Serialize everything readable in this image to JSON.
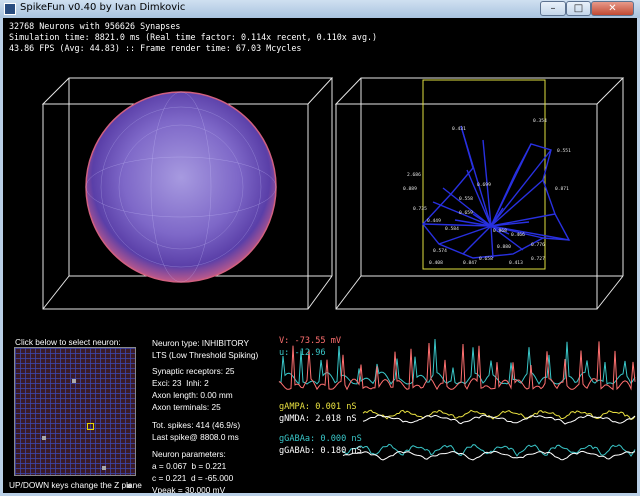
{
  "window": {
    "title": "SpikeFun v0.40 by Ivan Dimkovic",
    "min_glyph": "–",
    "max_glyph": "□",
    "close_glyph": "✕"
  },
  "stats": {
    "line1": "32768 Neurons with 956626 Synapses",
    "line2": "Simulation time: 8821.0 ms (Real time factor: 0.114x recent, 0.110x avg.)",
    "line3": "43.86 FPS (Avg: 44.83) :: Frame render time: 67.03 Mcycles"
  },
  "graph_labels": [
    "0.431",
    "0.354",
    "0.551",
    "2.686",
    "0.699",
    "0.889",
    "0.558",
    "0.659",
    "0.871",
    "0.735",
    "0.449",
    "0.868",
    "0.466",
    "0.584",
    "0.776",
    "0.658",
    "0.574",
    "0.727",
    "0.408",
    "0.413",
    "0.847",
    "0.880"
  ],
  "grid_panel": {
    "title": "Click below to select neuron:",
    "hint": "UP/DOWN keys change the Z plane"
  },
  "info": {
    "neuron_type": "Neuron type: INHIBITORY",
    "spiking": "LTS (Low Threshold Spiking)",
    "receptors": "Synaptic receptors: 25",
    "exci_inhi": "Exci: 23  Inhi: 2",
    "axon_length": "Axon length: 0.00 mm",
    "axon_terminals": "Axon terminals: 25",
    "tot_spikes": "Tot. spikes: 414 (46.9/s)",
    "last_spike": "Last spike@ 8808.0 ms",
    "params_title": "Neuron parameters:",
    "param_ab": "a = 0.067  b = 0.221",
    "param_cd": "c = 0.221  d = -65.000",
    "vpeak": "Vpeak = 30.000 mV"
  },
  "traces": {
    "v": "V: -73.55 mV",
    "u": "u: -12.96",
    "gampa": "gAMPA: 0.001 nS",
    "gnmda": "gNMDA: 2.018 nS",
    "ggabaa": "gGABAa: 0.000 nS",
    "ggabab": "gGABAb: 0.180 nS"
  },
  "colors": {
    "v_trace": "#ff7070",
    "u_trace": "#39c6c8",
    "ampa_trace": "#e8e040",
    "nmda_trace": "#ffffff",
    "gabaa_trace": "#39c6c8",
    "gabab_trace": "#ffffff",
    "graph_edges": "#2830e0",
    "z_plane": "#e0e040"
  }
}
